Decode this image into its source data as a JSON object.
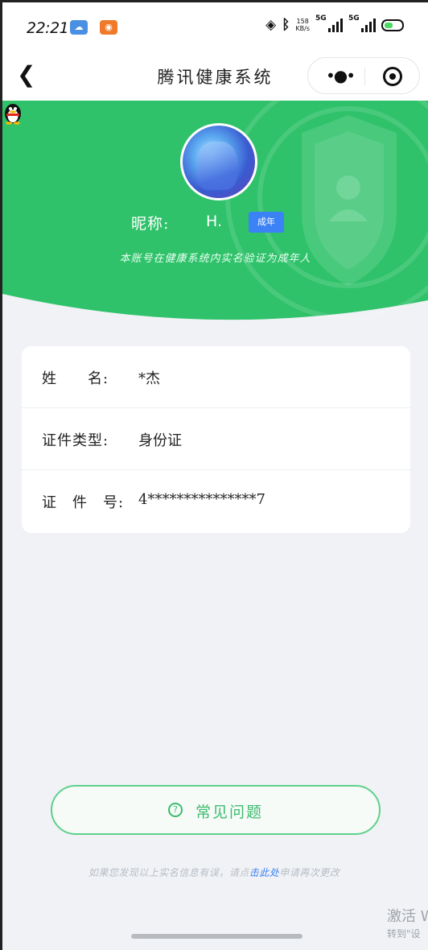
{
  "status_bar": {
    "time": "22:21",
    "net_speed_top": "158",
    "net_speed_unit": "KB/s",
    "signal_1_tag": "5G",
    "signal_2_tag": "5G"
  },
  "nav": {
    "title": "腾讯健康系统",
    "back_icon": "chevron-left-icon",
    "more_icon": "more-dots-icon",
    "close_icon": "target-circle-icon"
  },
  "profile": {
    "nickname_label": "昵称:",
    "nickname_value": "H.",
    "badge": "成年",
    "verified_text": "本账号在健康系统内实名验证为成年人"
  },
  "info": {
    "rows": [
      {
        "label": "姓　　名:",
        "value": "*杰"
      },
      {
        "label": "证件类型:",
        "value": "身份证"
      },
      {
        "label": "证　件　号:",
        "value": "4***************7"
      }
    ]
  },
  "faq": {
    "label": "常见问题",
    "icon": "question-circle-icon"
  },
  "footer": {
    "text_before": "如果您发现以上实名信息有误，请点",
    "link": "击此处",
    "text_after": "申请再次更改"
  },
  "watermark": {
    "line1": "激活 W",
    "line2": "转到\"设"
  },
  "colors": {
    "brand_green": "#2fc26a",
    "badge_blue": "#3b82f6",
    "faq_green": "#3dbb6e"
  }
}
